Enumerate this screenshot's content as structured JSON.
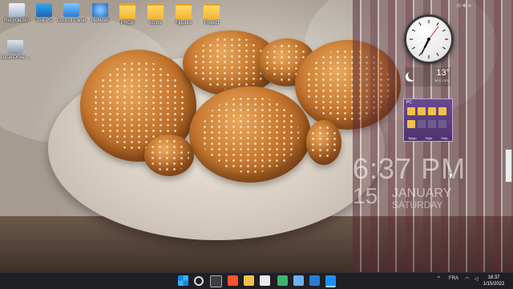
{
  "desktop_icons": [
    {
      "label": "Recycle Bin",
      "icon": "recycle-bin-icon"
    },
    {
      "label": "This PC",
      "icon": "monitor-icon"
    },
    {
      "label": "Control Panel",
      "icon": "control-panel-icon"
    },
    {
      "label": "Network",
      "icon": "network-icon"
    },
    {
      "label": "PROP",
      "icon": "folder-icon"
    },
    {
      "label": "Icons",
      "icon": "folder-icon"
    },
    {
      "label": "Figures",
      "icon": "folder-icon"
    },
    {
      "label": "Project",
      "icon": "folder-icon"
    },
    {
      "label": "Local Drive ...",
      "icon": "drive-icon"
    }
  ],
  "weather": {
    "temp": "13°",
    "sub": "14°C / 4°C"
  },
  "pc_gadget": {
    "title": "PC",
    "buttons": [
      "Begin",
      "Style",
      "Help"
    ]
  },
  "digital_clock": {
    "time": "6:37 PM",
    "day": "15",
    "month": "JANUARY",
    "weekday": "SATURDAY"
  },
  "tray": {
    "language": "FRA",
    "time": "18:37",
    "date": "1/15/2022"
  },
  "colors": {
    "taskbar": "#1f1f24",
    "accent": "#0078d4",
    "gadget_purple": "#6a4a8f"
  }
}
